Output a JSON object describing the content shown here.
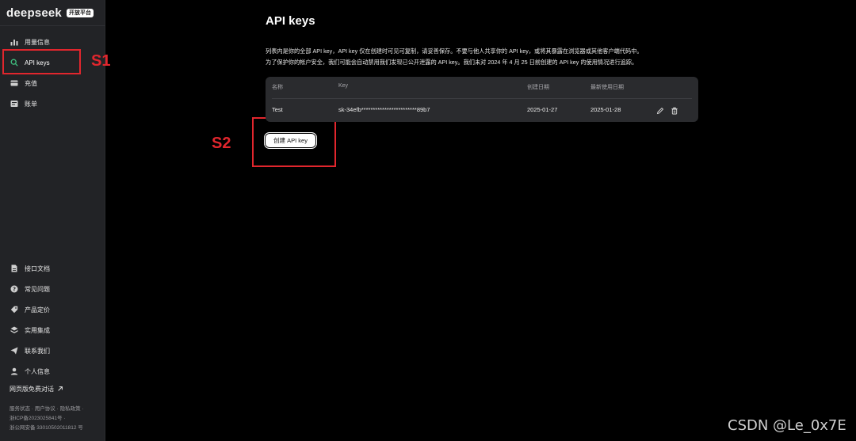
{
  "brand": {
    "logo_text": "deepseek",
    "badge": "开放平台"
  },
  "sidebar": {
    "top_items": [
      {
        "label": "用量信息",
        "icon": "bar-chart-icon"
      },
      {
        "label": "API keys",
        "icon": "search-icon",
        "active": true
      },
      {
        "label": "充值",
        "icon": "wallet-icon"
      },
      {
        "label": "账单",
        "icon": "bill-icon"
      }
    ],
    "bottom_items": [
      {
        "label": "接口文档",
        "icon": "document-icon"
      },
      {
        "label": "常见问题",
        "icon": "question-icon"
      },
      {
        "label": "产品定价",
        "icon": "tag-icon"
      },
      {
        "label": "实用集成",
        "icon": "layers-icon"
      },
      {
        "label": "联系我们",
        "icon": "send-icon"
      },
      {
        "label": "个人信息",
        "icon": "user-icon"
      }
    ],
    "web_chat": "网页版免费对话",
    "web_chat_icon": "external-arrow-icon",
    "footer": {
      "links": [
        "服务状态",
        "用户协议",
        "隐私政策"
      ],
      "icp": "浙ICP备2023025841号",
      "police": "浙公网安备 33010502011812 号"
    }
  },
  "annotations": {
    "s1": "S1",
    "s2": "S2",
    "color": "#e1262d"
  },
  "main": {
    "title": "API keys",
    "desc_line1": "列表内是你的全部 API key，API key 仅在创建时可见可复制，请妥善保存。不要与他人共享你的 API key，或将其暴露在浏览器或其他客户端代码中。",
    "desc_line2": "为了保护你的帐户安全，我们可能会自动禁用我们发现已公开泄露的 API key。我们未对 2024 年 4 月 25 日前创建的 API key 的使用情况进行追踪。",
    "table": {
      "headers": {
        "name": "名称",
        "key": "Key",
        "created": "创建日期",
        "last_used": "最新使用日期"
      },
      "rows": [
        {
          "name": "Test",
          "key": "sk-34efb************************89b7",
          "created": "2025-01-27",
          "last_used": "2025-01-28"
        }
      ]
    },
    "create_button": "创建 API key"
  },
  "watermark": "CSDN @Le_0x7E"
}
